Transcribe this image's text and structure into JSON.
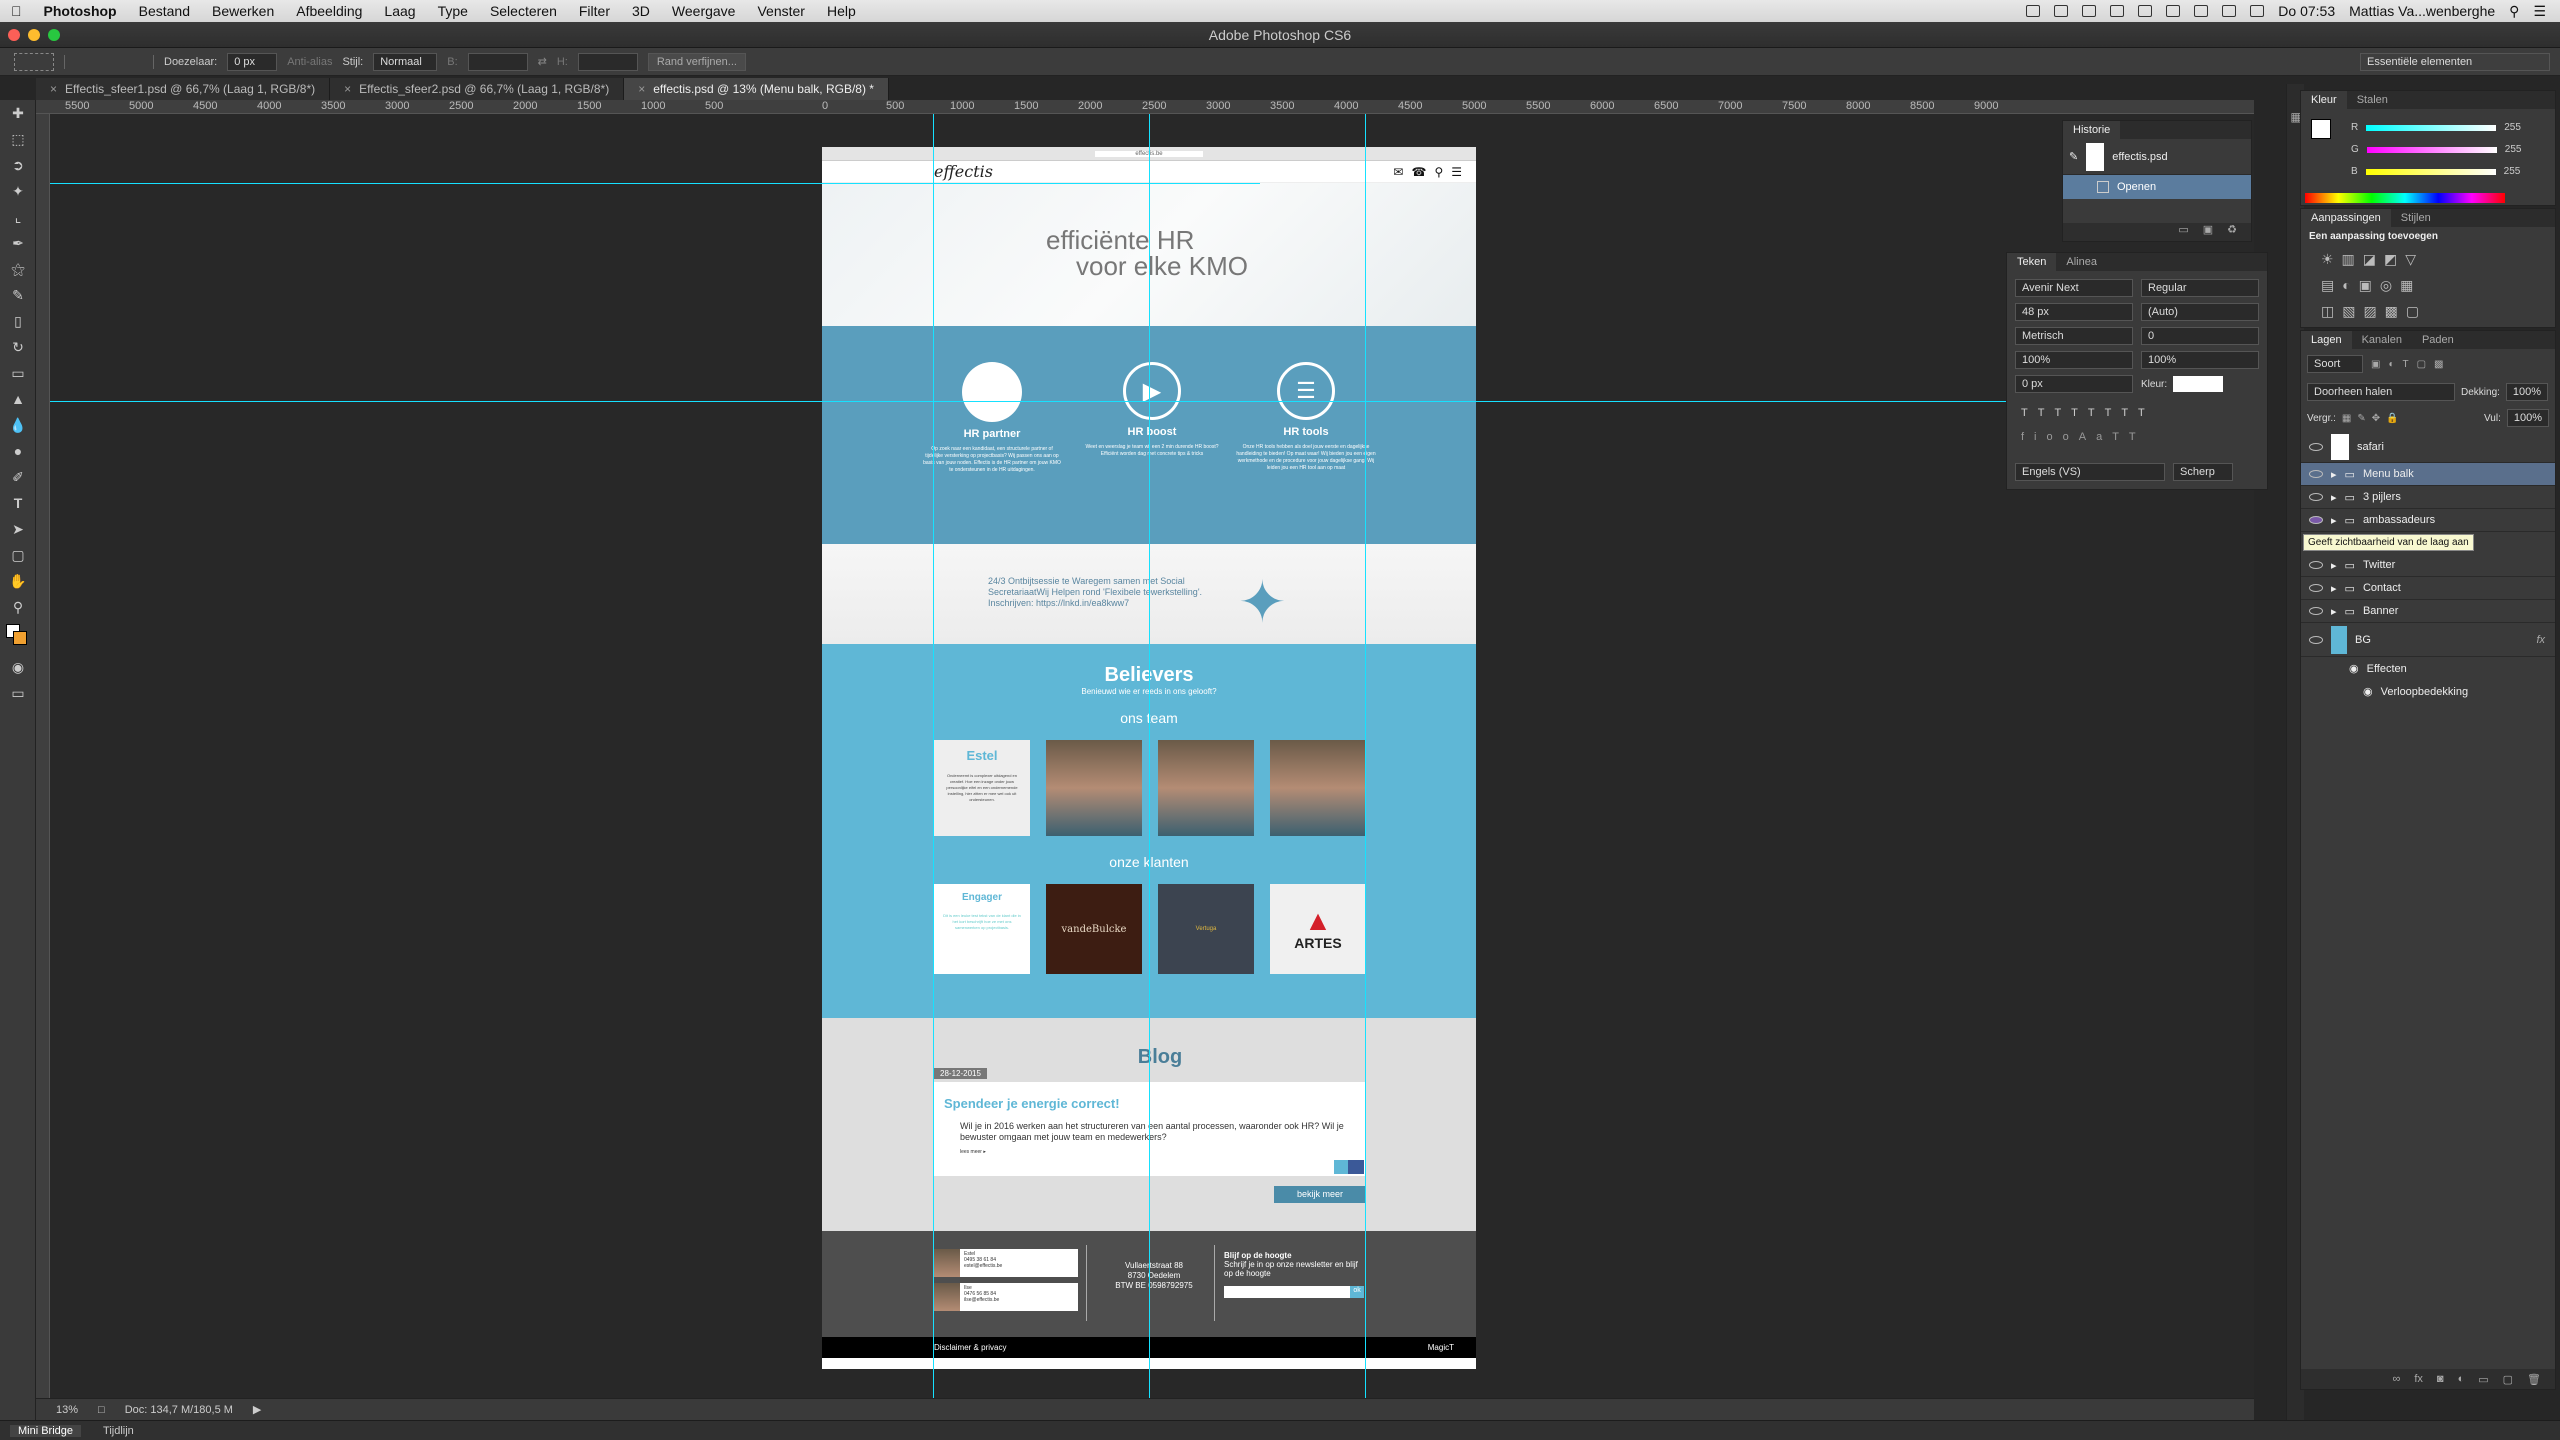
{
  "menubar": {
    "app": "Photoshop",
    "items": [
      "Bestand",
      "Bewerken",
      "Afbeelding",
      "Laag",
      "Type",
      "Selecteren",
      "Filter",
      "3D",
      "Weergave",
      "Venster",
      "Help"
    ],
    "clock": "Do 07:53",
    "user": "Mattias Va...wenberghe"
  },
  "window_title": "Adobe Photoshop CS6",
  "options": {
    "feather_label": "Doezelaar:",
    "feather_value": "0 px",
    "antialias": "Anti-alias",
    "style_label": "Stijl:",
    "style_value": "Normaal",
    "width_label": "B:",
    "height_label": "H:",
    "refine_edge": "Rand verfijnen...",
    "workspace": "Essentiële elementen"
  },
  "doc_tabs": [
    {
      "label": "Effectis_sfeer1.psd @ 66,7% (Laag 1, RGB/8*)",
      "active": false
    },
    {
      "label": "Effectis_sfeer2.psd @ 66,7% (Laag 1, RGB/8*)",
      "active": false
    },
    {
      "label": "effectis.psd @ 13% (Menu balk, RGB/8) *",
      "active": true
    }
  ],
  "ruler_labels": [
    "5500",
    "5000",
    "4500",
    "4000",
    "3500",
    "3000",
    "2500",
    "2000",
    "1500",
    "1000",
    "500",
    "0",
    "500",
    "1000",
    "1500",
    "2000",
    "2500",
    "3000",
    "3500",
    "4000",
    "4500",
    "5000",
    "5500",
    "6000",
    "6500",
    "7000",
    "7500",
    "8000",
    "8500",
    "9000"
  ],
  "status": {
    "zoom": "13%",
    "doc_size": "Doc: 134,7 M/180,5 M"
  },
  "bottom_tabs": [
    "Mini Bridge",
    "Tijdlijn"
  ],
  "site": {
    "url": "effectis.be",
    "logo": "effectis",
    "hero": [
      "efficiënte HR",
      "voor elke KMO"
    ],
    "pillars": [
      {
        "title": "HR partner",
        "text": "Op zoek naar een kandidaat, een structurele partner of tijdelijke versterking op projectbasis? Wij passen ons aan op basis van jouw noden. Effectis is de HR partner om jouw KMO te ondersteunen in de HR uitdagingen."
      },
      {
        "title": "HR boost",
        "text": "Weet en weerslag je team wil een 2 min durende HR boost? Efficiënt worden dag met concrete tips & tricks"
      },
      {
        "title": "HR tools",
        "text": "Onze HR tools hebben als doel jouw eerste en dagelijkse handleiding te bieden! Op maat waar! Wij bieden jou een eigen werkmethode en de procedure voor jouw dagelijkse gang. Wij leiden jou een HR tool aan op maat"
      }
    ],
    "tweet": "24/3 Ontbijtsessie te Waregem samen met Social SecretariaatWij Helpen rond 'Flexibele tewerkstelling'. Inschrijven: https://lnkd.in/ea8kww7",
    "believers_title": "Believers",
    "believers_sub": "Benieuwd wie er reeds in ons gelooft?",
    "team_title": "ons team",
    "team_card_name": "Estel",
    "team_card_text": "Onderneemt is complexer uitdagend en creatief. Hoe een inzage onder jouw persoonlijke eifel en een ondernemende instelling, hier zitten er mee wel ook uit ondersteunen.",
    "clients_title": "onze klanten",
    "clients": [
      "Engager",
      "vandeBulcke",
      "Vertuga",
      "ARTES"
    ],
    "client_text": "Dit is een leuke test tekst van de klant die in het kort beschrijft hoe ze met ons samenwerken op projectbasis.",
    "blog_title": "Blog",
    "blog_date": "28-12-2015",
    "blog_post_title": "Spendeer je energie correct!",
    "blog_post_text": "Wil je in 2016 werken aan het structureren van een aantal processen, waaronder ook HR? Wil je bewuster omgaan met jouw team en medewerkers?",
    "blog_read": "lees meer ▸",
    "blog_more": "bekijk meer",
    "contacts": [
      {
        "name": "Estel",
        "phone": "0495 38 61 84",
        "mail": "estel@effectis.be"
      },
      {
        "name": "Ilse",
        "phone": "0476 56 85 84",
        "mail": "ilse@effectis.be"
      }
    ],
    "address": [
      "Vullaertstraat 88",
      "8730 Oedelem",
      "BTW BE 0598792975"
    ],
    "newsletter_title": "Blijf op de hoogte",
    "newsletter_text": "Schrijf je in op onze newsletter en blijf op de hoogte",
    "newsletter_btn": "ok",
    "footer_left": "Disclaimer & privacy",
    "footer_right": "MagicT"
  },
  "history": {
    "title": "Historie",
    "doc": "effectis.psd",
    "step": "Openen"
  },
  "character": {
    "tabs": [
      "Teken",
      "Alinea"
    ],
    "font": "Avenir Next",
    "style": "Regular",
    "size": "48 px",
    "leading": "(Auto)",
    "kerning": "Metrisch",
    "tracking": "0",
    "vscale": "100%",
    "hscale": "100%",
    "baseline": "0 px",
    "color_label": "Kleur:",
    "language": "Engels (VS)",
    "aa": "Scherp"
  },
  "color_panel": {
    "tabs": [
      "Kleur",
      "Stalen"
    ],
    "r": "255",
    "g": "255",
    "b": "255"
  },
  "adjust": {
    "tabs": [
      "Aanpassingen",
      "Stijlen"
    ],
    "title": "Een aanpassing toevoegen"
  },
  "layers_panel": {
    "tabs": [
      "Lagen",
      "Kanalen",
      "Paden"
    ],
    "kind": "Soort",
    "blend": "Doorheen halen",
    "opacity_label": "Dekking:",
    "opacity": "100%",
    "lock_label": "Vergr.:",
    "fill_label": "Vul:",
    "fill": "100%",
    "tooltip": "Geeft zichtbaarheid van de laag aan",
    "layers": [
      "safari",
      "Menu balk",
      "3 pijlers",
      "ambassadeurs",
      "Twitter",
      "Contact",
      "Banner",
      "BG"
    ],
    "effects": "Effecten",
    "gradient": "Verloopbedekking"
  }
}
